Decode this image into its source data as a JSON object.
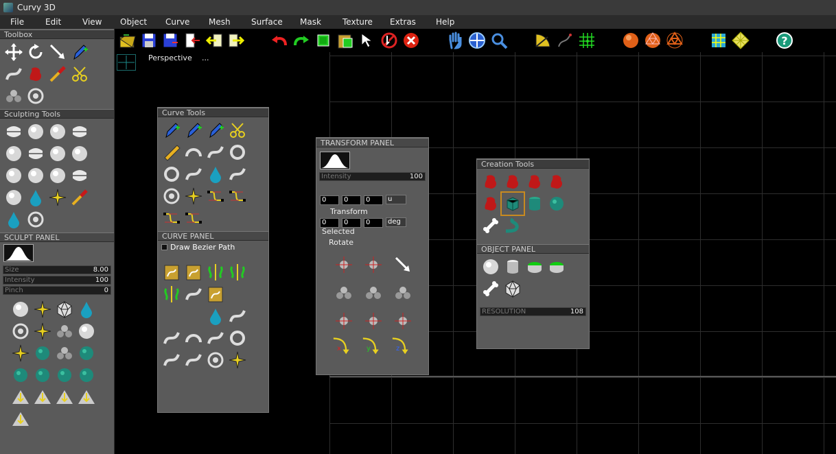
{
  "app": {
    "title": "Curvy 3D"
  },
  "menu": [
    "File",
    "Edit",
    "View",
    "Object",
    "Curve",
    "Mesh",
    "Surface",
    "Mask",
    "Texture",
    "Extras",
    "Help"
  ],
  "toolbar": {
    "icons": [
      "open-folder-icon",
      "save-icon",
      "save-as-icon",
      "import-icon",
      "export-left-icon",
      "export-right-icon",
      "undo-icon",
      "redo-icon",
      "copy-object-icon",
      "paste-object-icon",
      "select-arrow-icon",
      "no-select-icon",
      "close-icon",
      "hand-pan-icon",
      "rotate-view-icon",
      "zoom-icon",
      "measure-icon",
      "curve-tool-icon",
      "grid-snap-icon",
      "sphere-shade-icon",
      "sphere-wire-icon",
      "sphere-outline-icon",
      "grid-floor-icon",
      "diamond-grid-icon",
      "help-icon"
    ]
  },
  "toolbox": {
    "title": "Toolbox"
  },
  "sculpting": {
    "title": "Sculpting Tools"
  },
  "sculpt_panel": {
    "title": "SCULPT    PANEL",
    "size_label": "Size",
    "size_value": "8.00",
    "intensity_label": "Intensity",
    "intensity_value": "100",
    "pinch_label": "Pinch",
    "pinch_value": "0"
  },
  "viewport": {
    "label": "Perspective",
    "dots": "..."
  },
  "curve_tools": {
    "title": "Curve Tools"
  },
  "curve_panel": {
    "title": "CURVE    PANEL",
    "draw_bezier": "Draw Bezier Path"
  },
  "transform_panel": {
    "title": "TRANSFORM    PANEL",
    "intensity_label": "Intensity",
    "intensity_value": "100",
    "row1": [
      "0",
      "0",
      "0"
    ],
    "unit1": "u",
    "transform_label": "Transform",
    "row2": [
      "0",
      "0",
      "0"
    ],
    "unit2": "deg",
    "selected_label": "Selected",
    "rotate_label": "Rotate",
    "axis_labels": [
      "x",
      "y",
      "z"
    ]
  },
  "creation_tools": {
    "title": "Creation Tools"
  },
  "object_panel": {
    "title": "OBJECT    PANEL",
    "resolution_label": "RESOLUTION",
    "resolution_value": "108"
  },
  "colors": {
    "accent_red": "#c01818",
    "accent_green": "#2aa82a",
    "teal": "#1e8a7a",
    "yellow": "#e8d020",
    "viewport_bg": "#000000",
    "panel_bg": "#5a5a5a"
  }
}
